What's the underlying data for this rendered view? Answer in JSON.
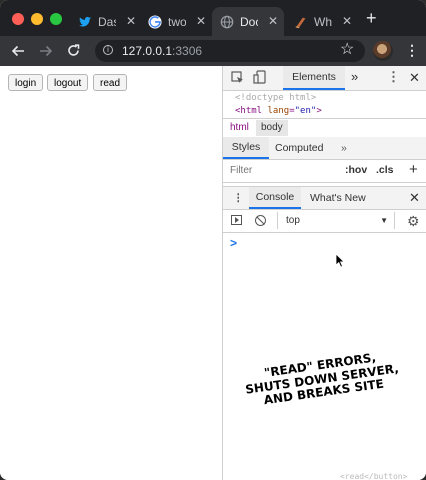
{
  "colors": {
    "close": "#ff5f57",
    "minimize": "#febc2e",
    "maximize": "#28c840",
    "accent": "#1a73e8",
    "chrome_dark": "#202124"
  },
  "tabs": [
    {
      "title": "Das",
      "icon": "twitter-bird-icon"
    },
    {
      "title": "two",
      "icon": "google-g-icon"
    },
    {
      "title": "Doc",
      "icon": "globe-icon"
    },
    {
      "title": "Wh",
      "icon": "scroll-icon"
    }
  ],
  "new_tab": "+",
  "address": {
    "host": "127.0.0.1",
    "port": ":3306"
  },
  "page": {
    "buttons": [
      "login",
      "logout",
      "read"
    ]
  },
  "devtools": {
    "main_tab": "Elements",
    "more": "»",
    "doctype": "<!doctype html>",
    "html_tag_open": "<html",
    "html_attr": "lang",
    "html_eq": "=",
    "html_val": "\"en\"",
    "html_close": ">",
    "crumbs": [
      "html",
      "body"
    ],
    "style_tabs": [
      "Styles",
      "Computed"
    ],
    "filter_placeholder": "Filter",
    "hov": ":hov",
    "cls": ".cls",
    "plus": "+",
    "drawer_tabs": [
      "Console",
      "What's New"
    ],
    "context": "top",
    "prompt": ">"
  },
  "caption": [
    "\"READ\" ERRORS,",
    "SHUTS DOWN SERVER,",
    "AND BREAKS SITE"
  ],
  "bottom_peek": "<read</button>"
}
